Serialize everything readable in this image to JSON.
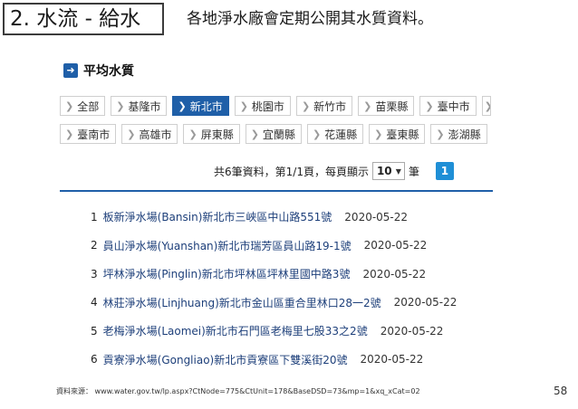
{
  "slide": {
    "title": "2. 水流 - 給水",
    "subtitle": "各地淨水廠會定期公開其水質資料。",
    "page_number": "58",
    "source": "資料來源： www.water.gov.tw/lp.aspx?CtNode=775&CtUnit=178&BaseDSD=73&mp=1&xq_xCat=02"
  },
  "section": {
    "icon": "arrow-right-icon",
    "title": "平均水質"
  },
  "filters": {
    "row1": [
      {
        "label": "全部",
        "active": false
      },
      {
        "label": "基隆市",
        "active": false
      },
      {
        "label": "新北市",
        "active": true
      },
      {
        "label": "桃園市",
        "active": false
      },
      {
        "label": "新竹市",
        "active": false
      },
      {
        "label": "苗栗縣",
        "active": false
      },
      {
        "label": "臺中市",
        "active": false
      }
    ],
    "row2": [
      {
        "label": "臺南市",
        "active": false
      },
      {
        "label": "高雄市",
        "active": false
      },
      {
        "label": "屏東縣",
        "active": false
      },
      {
        "label": "宜蘭縣",
        "active": false
      },
      {
        "label": "花蓮縣",
        "active": false
      },
      {
        "label": "臺東縣",
        "active": false
      },
      {
        "label": "澎湖縣",
        "active": false
      }
    ]
  },
  "pager": {
    "summary": "共6筆資料，第1/1頁，每頁顯示",
    "per_page": "10",
    "unit": "筆",
    "current_page": "1"
  },
  "results": [
    {
      "num": "1",
      "text": "板新淨水場(Bansin)新北市三峽區中山路551號",
      "date": "2020-05-22"
    },
    {
      "num": "2",
      "text": "員山淨水場(Yuanshan)新北市瑞芳區員山路19-1號",
      "date": "2020-05-22"
    },
    {
      "num": "3",
      "text": "坪林淨水場(Pinglin)新北市坪林區坪林里國中路3號",
      "date": "2020-05-22"
    },
    {
      "num": "4",
      "text": "林莊淨水場(Linjhuang)新北市金山區重合里林口28一2號",
      "date": "2020-05-22"
    },
    {
      "num": "5",
      "text": "老梅淨水場(Laomei)新北市石門區老梅里七股33之2號",
      "date": "2020-05-22"
    },
    {
      "num": "6",
      "text": "貢寮淨水場(Gongliao)新北市貢寮區下雙溪街20號",
      "date": "2020-05-22"
    }
  ],
  "colors": {
    "accent": "#1f5fa8",
    "page_button": "#1f8fd6",
    "link": "#1d3f7a"
  }
}
